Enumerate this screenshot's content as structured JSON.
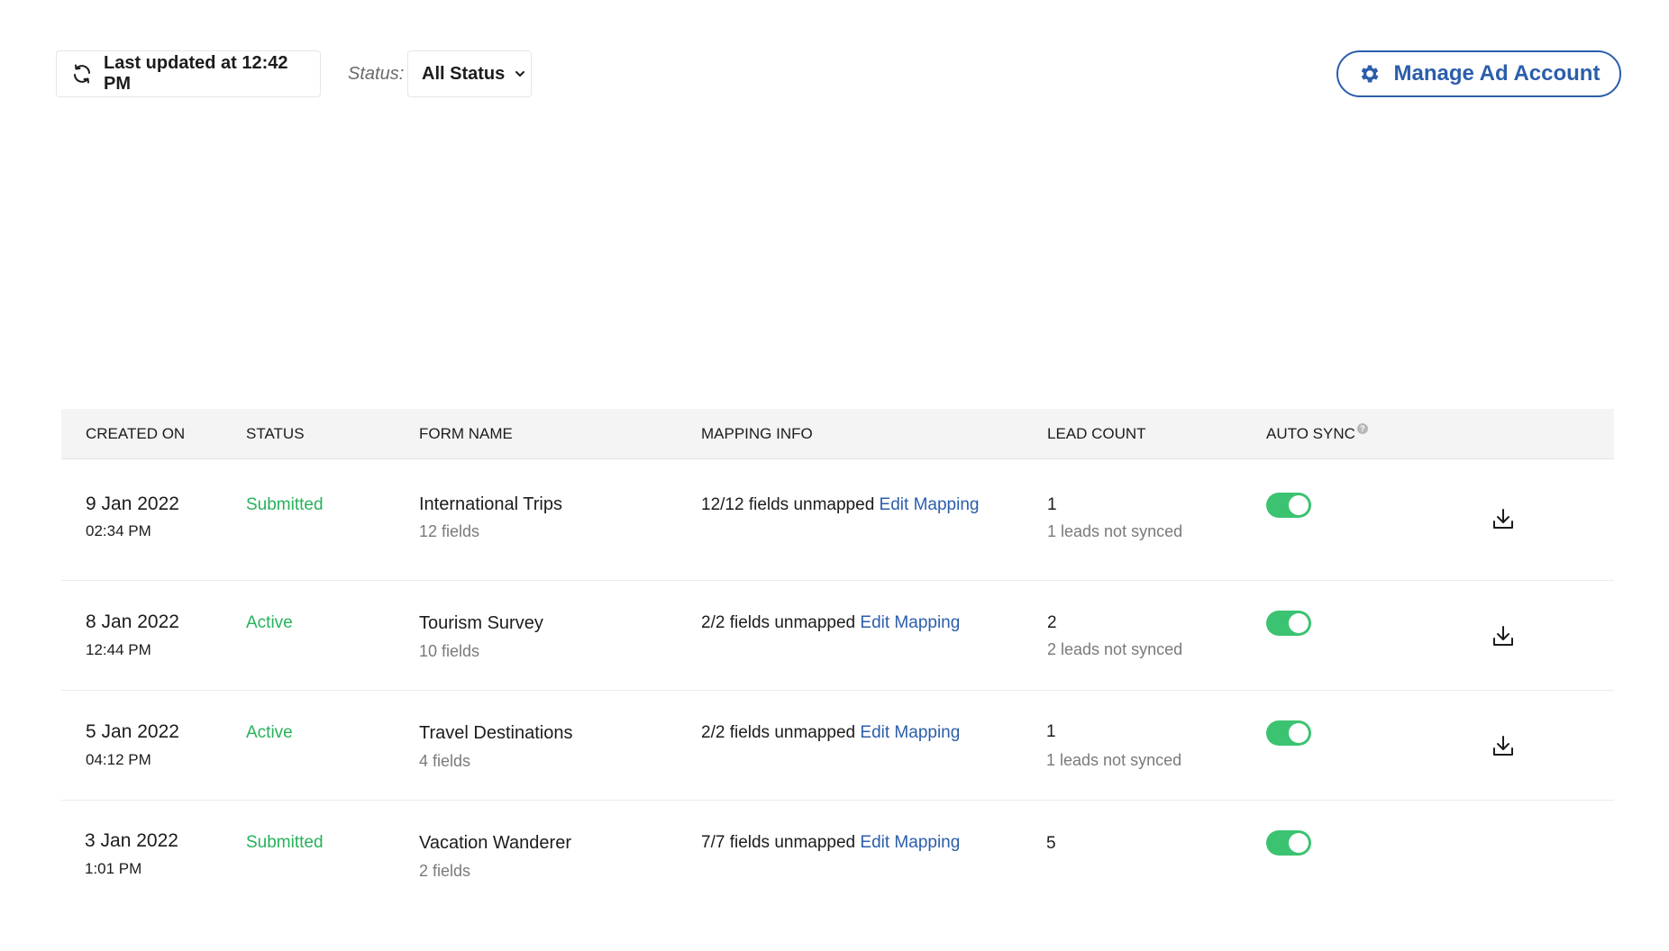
{
  "toolbar": {
    "refresh_label": "Last updated at 12:42 PM",
    "status_label": "Status:",
    "status_value": "All Status",
    "manage_label": "Manage Ad Account"
  },
  "table": {
    "headers": {
      "created_on": "CREATED ON",
      "status": "STATUS",
      "form_name": "FORM NAME",
      "mapping_info": "MAPPING INFO",
      "lead_count": "LEAD COUNT",
      "auto_sync": "AUTO SYNC"
    },
    "edit_mapping_label": "Edit Mapping",
    "rows": [
      {
        "date": "9 Jan 2022",
        "time": "02:34 PM",
        "status": "Submitted",
        "form_name": "International Trips",
        "fields": "12 fields",
        "mapping": "12/12 fields unmapped",
        "edit": "Edit Mapping",
        "count": "1",
        "not_synced": "1 leads not synced",
        "auto_sync": true,
        "download": true
      },
      {
        "date": "8 Jan 2022",
        "time": "12:44 PM",
        "status": "Active",
        "form_name": "Tourism Survey",
        "fields": "10 fields",
        "mapping": "2/2 fields unmapped",
        "edit": "Edit Mapping",
        "count": "2",
        "not_synced": "2 leads not synced",
        "auto_sync": true,
        "download": true
      },
      {
        "date": "5 Jan 2022",
        "time": "04:12 PM",
        "status": "Active",
        "form_name": "Travel Destinations",
        "fields": "4 fields",
        "mapping": "2/2 fields unmapped",
        "edit": "Edit Mapping",
        "count": "1",
        "not_synced": "1 leads not synced",
        "auto_sync": true,
        "download": true
      },
      {
        "date": "3 Jan 2022",
        "time": "1:01 PM",
        "status": "Submitted",
        "form_name": "Vacation Wanderer",
        "fields": "2 fields",
        "mapping": "7/7 fields unmapped",
        "edit": "Edit Mapping",
        "count": "5",
        "not_synced": "",
        "auto_sync": true,
        "download": false
      }
    ]
  },
  "icons": {
    "refresh": "refresh-icon",
    "dropdown": "chevron-down-icon",
    "manage": "gear-icon",
    "help": "help-icon",
    "download": "download-icon"
  },
  "colors": {
    "accent": "#2b5eab",
    "status_green": "#27b25c",
    "toggle_on": "#3cc372",
    "header_bg": "#f4f4f4"
  }
}
